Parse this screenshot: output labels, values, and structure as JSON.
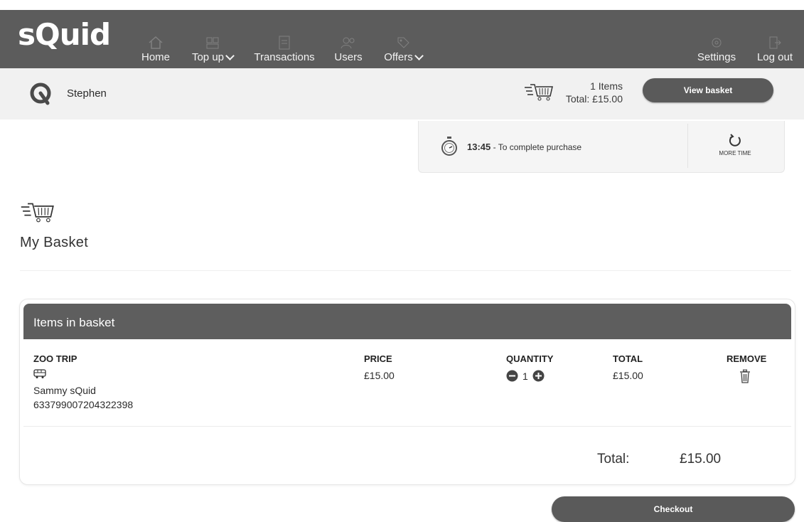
{
  "app": {
    "logo": "sQuid"
  },
  "nav": {
    "items": [
      {
        "label": "Home",
        "dropdown": false
      },
      {
        "label": "Top up",
        "dropdown": true
      },
      {
        "label": "Transactions",
        "dropdown": false
      },
      {
        "label": "Users",
        "dropdown": false
      },
      {
        "label": "Offers",
        "dropdown": true
      }
    ],
    "right": [
      {
        "label": "Settings"
      },
      {
        "label": "Log out"
      }
    ]
  },
  "userbar": {
    "name": "Stephen",
    "items_count": "1 Items",
    "total": "Total: £15.00",
    "view_basket": "View basket"
  },
  "timer": {
    "time": "13:45",
    "text": " - To complete purchase",
    "more_time": "MORE TIME"
  },
  "basket": {
    "title": "My Basket",
    "panel_title": "Items in basket",
    "columns": {
      "item": "ZOO TRIP",
      "price": "PRICE",
      "quantity": "QUANTITY",
      "total": "TOTAL",
      "remove": "REMOVE"
    },
    "item": {
      "name": "Sammy sQuid",
      "number": "633799007204322398",
      "price": "£15.00",
      "quantity": "1",
      "total": "£15.00"
    },
    "total_label": "Total:",
    "total_value": "£15.00",
    "checkout": "Checkout"
  },
  "colors": {
    "header": "#5c5c5c",
    "userbar": "#f1f1f1",
    "button": "#5a5a5a"
  }
}
